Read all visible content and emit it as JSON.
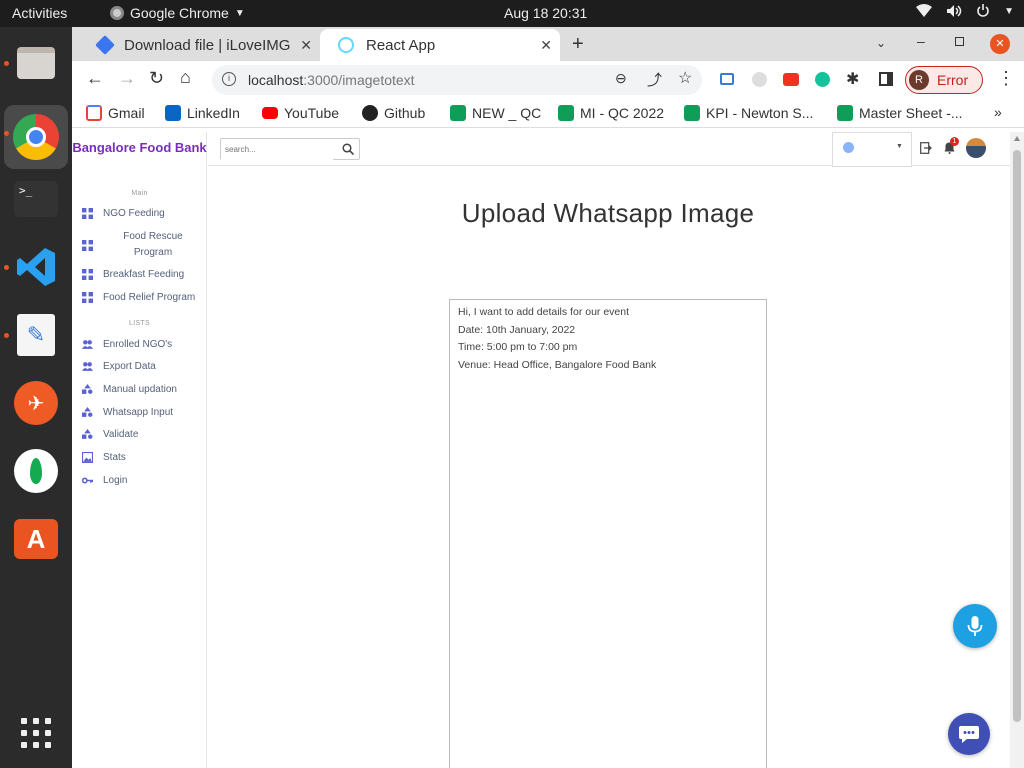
{
  "system": {
    "activities": "Activities",
    "app_name": "Google Chrome",
    "clock": "Aug 18  20:31"
  },
  "browser": {
    "tabs": [
      {
        "title": "Download file | iLoveIMG"
      },
      {
        "title": "React App"
      }
    ],
    "url_host": "localhost",
    "url_path": ":3000/imagetotext",
    "profile_initial": "R",
    "profile_status": "Error",
    "bookmarks": [
      {
        "label": "Gmail",
        "icon": "gmail-icon",
        "color": "#ea4335"
      },
      {
        "label": "LinkedIn",
        "icon": "linkedin-icon",
        "color": "#0a66c2"
      },
      {
        "label": "YouTube",
        "icon": "youtube-icon",
        "color": "#ff0000"
      },
      {
        "label": "Github",
        "icon": "github-icon",
        "color": "#222222"
      },
      {
        "label": "NEW _ QC",
        "icon": "sheets-icon",
        "color": "#0f9d58"
      },
      {
        "label": "MI - QC 2022",
        "icon": "sheets-icon",
        "color": "#0f9d58"
      },
      {
        "label": "KPI - Newton S...",
        "icon": "sheets-icon",
        "color": "#0f9d58"
      },
      {
        "label": "Master Sheet -...",
        "icon": "sheets-icon",
        "color": "#0f9d58"
      }
    ]
  },
  "app": {
    "brand": "Bangalore Food Bank",
    "search_placeholder": "search...",
    "notification_count": "1",
    "sections": {
      "main": "Main",
      "lists": "LISTS"
    },
    "main_items": [
      {
        "label": "NGO Feeding",
        "icon": "dashboard-icon"
      },
      {
        "label": "Food Rescue Program",
        "icon": "dashboard-icon"
      },
      {
        "label": "Breakfast Feeding",
        "icon": "dashboard-icon"
      },
      {
        "label": "Food Relief Program",
        "icon": "dashboard-icon"
      }
    ],
    "list_items": [
      {
        "label": "Enrolled NGO's",
        "icon": "people-icon"
      },
      {
        "label": "Export Data",
        "icon": "people-icon"
      },
      {
        "label": "Manual updation",
        "icon": "shapes-icon"
      },
      {
        "label": "Whatsapp Input",
        "icon": "shapes-icon"
      },
      {
        "label": "Validate",
        "icon": "shapes-icon"
      },
      {
        "label": "Stats",
        "icon": "image-icon"
      },
      {
        "label": "Login",
        "icon": "key-icon"
      }
    ],
    "page_title": "Upload Whatsapp Image",
    "extracted_text": "Hi, I want to add details for our event\nDate: 10th January, 2022\nTime: 5:00 pm to 7:00 pm\nVenue: Head Office, Bangalore Food Bank",
    "accent_color": "#7b2cbf",
    "icon_color": "#5b63d3"
  }
}
